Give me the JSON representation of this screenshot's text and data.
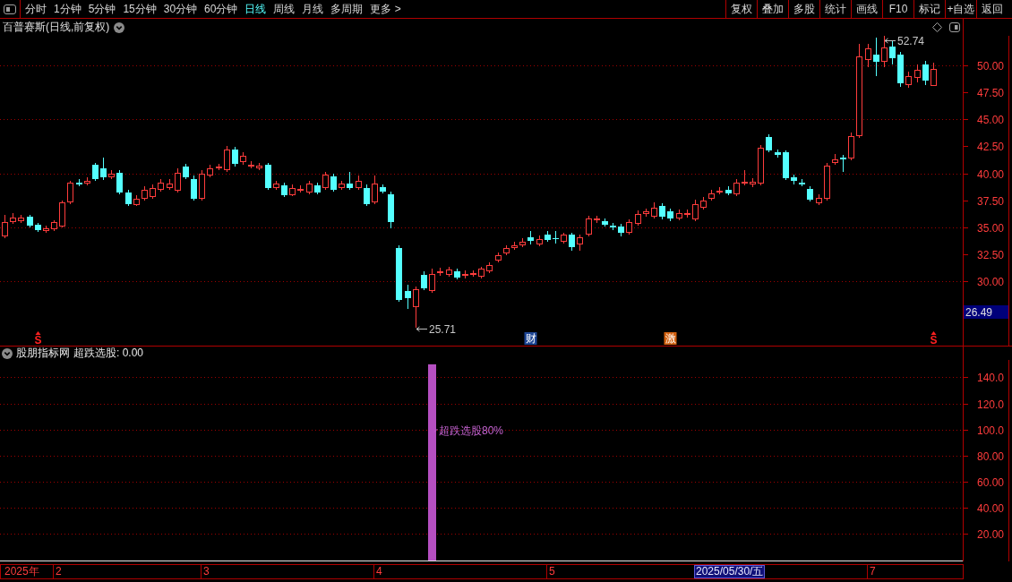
{
  "toolbar": {
    "periods": [
      {
        "label": "分时",
        "selected": false
      },
      {
        "label": "1分钟",
        "selected": false
      },
      {
        "label": "5分钟",
        "selected": false
      },
      {
        "label": "15分钟",
        "selected": false
      },
      {
        "label": "30分钟",
        "selected": false
      },
      {
        "label": "60分钟",
        "selected": false
      },
      {
        "label": "日线",
        "selected": true
      },
      {
        "label": "周线",
        "selected": false
      },
      {
        "label": "月线",
        "selected": false
      },
      {
        "label": "多周期",
        "selected": false
      },
      {
        "label": "更多 >",
        "selected": false
      }
    ],
    "buttons": [
      "复权",
      "叠加",
      "多股",
      "统计",
      "画线",
      "F10",
      "标记",
      "+自选",
      "返回"
    ]
  },
  "price_chart": {
    "title": "百普赛斯(日线,前复权)",
    "y_axis": [
      "50.00",
      "47.50",
      "45.00",
      "42.50",
      "40.00",
      "37.50",
      "35.00",
      "32.50",
      "30.00"
    ],
    "high_label": "52.74",
    "low_label": "25.71",
    "cursor_price": "26.49",
    "markers": [
      {
        "kind": "signal",
        "text": "S",
        "color": "#ff2020"
      },
      {
        "kind": "tag",
        "text": "财",
        "color": "#1d4594"
      },
      {
        "kind": "tag",
        "text": "激",
        "color": "#d2600f"
      },
      {
        "kind": "signal",
        "text": "S",
        "color": "#ff2020"
      }
    ]
  },
  "indicator": {
    "source": "股朋指标网",
    "reading": "超跌选股: 0.00",
    "chart_data": {
      "type": "bar",
      "grid": true,
      "categories": [
        null,
        null,
        null,
        null,
        null,
        null,
        null,
        null,
        null,
        null,
        null,
        null,
        null,
        null,
        null,
        null,
        null,
        null,
        null,
        null,
        null,
        null,
        null,
        null,
        null,
        null,
        null,
        null,
        null,
        null,
        null,
        null,
        null,
        null,
        null,
        null,
        null,
        null,
        null,
        null,
        null,
        null,
        null,
        null,
        null,
        null,
        null,
        null,
        null,
        null,
        null,
        null,
        null,
        null,
        null,
        null,
        null,
        null,
        null,
        null,
        null,
        null,
        null,
        null,
        null,
        null,
        null,
        null,
        null,
        null,
        null,
        null,
        null,
        null,
        null,
        null,
        null,
        null,
        null,
        null,
        null,
        null,
        null,
        null,
        null,
        null,
        null,
        null,
        null,
        null,
        null,
        null,
        null,
        null,
        null,
        null,
        null,
        null,
        null,
        null,
        null,
        null,
        null,
        null,
        null,
        null,
        null,
        null,
        null,
        null,
        null,
        null,
        null,
        null,
        null,
        null,
        null
      ],
      "ylim": [
        0,
        153
      ],
      "yticks": [
        {
          "value": 140,
          "label": "140.0"
        },
        {
          "value": 120,
          "label": "120.0"
        },
        {
          "value": 100,
          "label": "100.0"
        },
        {
          "value": 80,
          "label": "80.00"
        },
        {
          "value": 60,
          "label": "60.00"
        },
        {
          "value": 40,
          "label": "40.00"
        },
        {
          "value": 20,
          "label": "20.00"
        }
      ],
      "series": [
        {
          "color": "#b54fc1",
          "values": [
            null,
            null,
            null,
            null,
            null,
            null,
            null,
            null,
            null,
            null,
            null,
            null,
            null,
            null,
            null,
            null,
            null,
            null,
            null,
            null,
            null,
            null,
            null,
            null,
            null,
            null,
            null,
            null,
            null,
            null,
            null,
            null,
            null,
            null,
            null,
            null,
            null,
            null,
            null,
            null,
            null,
            null,
            null,
            null,
            null,
            null,
            null,
            null,
            null,
            null,
            null,
            null,
            150,
            null,
            null,
            null,
            null,
            null,
            null,
            null,
            null,
            null,
            null,
            null,
            null,
            null,
            null,
            null,
            null,
            null,
            null,
            null,
            null,
            null,
            null,
            null,
            null,
            null,
            null,
            null,
            null,
            null,
            null,
            null,
            null,
            null,
            null,
            null,
            null,
            null,
            null,
            null,
            null,
            null,
            null,
            null,
            null,
            null,
            null,
            null,
            null,
            null,
            null,
            null,
            null,
            null,
            null,
            null,
            null,
            null,
            null,
            null,
            null,
            null,
            null,
            null,
            null
          ]
        }
      ],
      "annotations": [
        "超跌选股80%"
      ]
    }
  },
  "date_axis": {
    "labels": [
      "2025年",
      "2",
      "3",
      "4",
      "5",
      "7"
    ],
    "cursor_date": "2025/05/30/五"
  }
}
